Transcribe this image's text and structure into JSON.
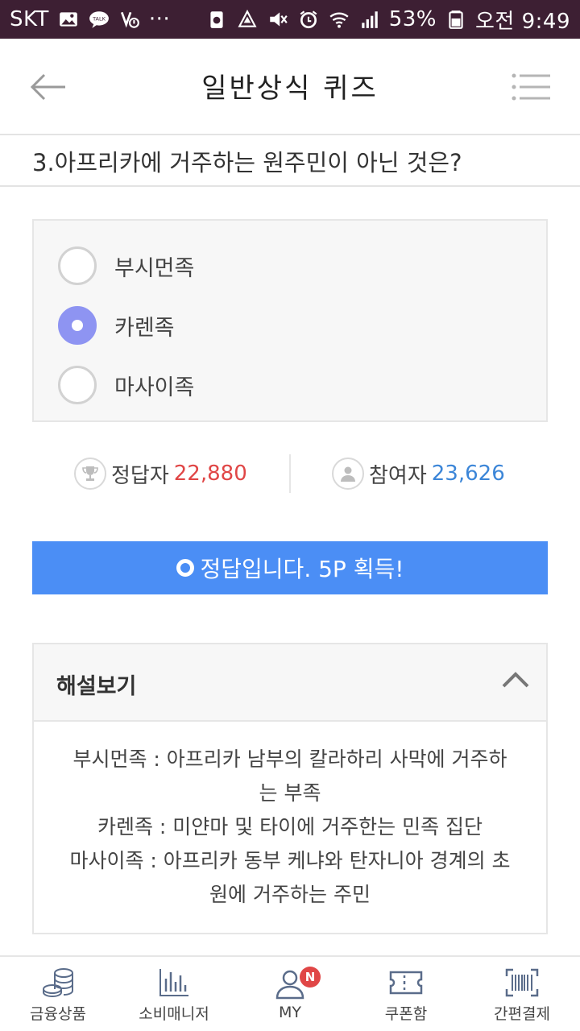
{
  "status_bar": {
    "carrier": "SKT",
    "dots": "···",
    "battery_percent": "53%",
    "time": "오전 9:49",
    "left_icons": [
      "image-icon",
      "talk-icon",
      "voice-icon"
    ],
    "right_icons": [
      "recycle-icon",
      "nfc-icon",
      "mute-icon",
      "alarm-icon",
      "wifi-icon",
      "signal-icon",
      "battery-icon"
    ]
  },
  "header": {
    "title": "일반상식 퀴즈"
  },
  "question": {
    "text": "3.아프리카에 거주하는 원주민이 아닌 것은?"
  },
  "options": [
    {
      "label": "부시먼족",
      "selected": false
    },
    {
      "label": "카렌족",
      "selected": true
    },
    {
      "label": "마사이족",
      "selected": false
    }
  ],
  "stats": {
    "correct_label": "정답자",
    "correct_value": "22,880",
    "participants_label": "참여자",
    "participants_value": "23,626"
  },
  "result": {
    "text": "정답입니다. 5P 획득!"
  },
  "explanation": {
    "title": "해설보기",
    "lines": [
      "부시먼족 : 아프리카 남부의 칼라하리 사막에 거주하",
      "는 부족",
      "카렌족 : 미얀마 및 타이에 거주한는 민족 집단",
      "마사이족 : 아프리카 동부 케냐와 탄자니아 경계의 초",
      "원에 거주하는 주민"
    ]
  },
  "bottom_nav": {
    "items": [
      {
        "label": "금융상품",
        "icon": "coins-icon"
      },
      {
        "label": "소비매니저",
        "icon": "bar-chart-icon"
      },
      {
        "label": "MY",
        "icon": "person-icon",
        "badge": "N"
      },
      {
        "label": "쿠폰함",
        "icon": "coupon-icon"
      },
      {
        "label": "간편결제",
        "icon": "barcode-icon"
      }
    ]
  },
  "colors": {
    "status_bar_bg": "#3d1f33",
    "radio_selected": "#8e94f2",
    "correct_count": "#e04646",
    "participants_count": "#3c86d8",
    "result_banner": "#4b8ef5",
    "badge": "#e04646"
  }
}
